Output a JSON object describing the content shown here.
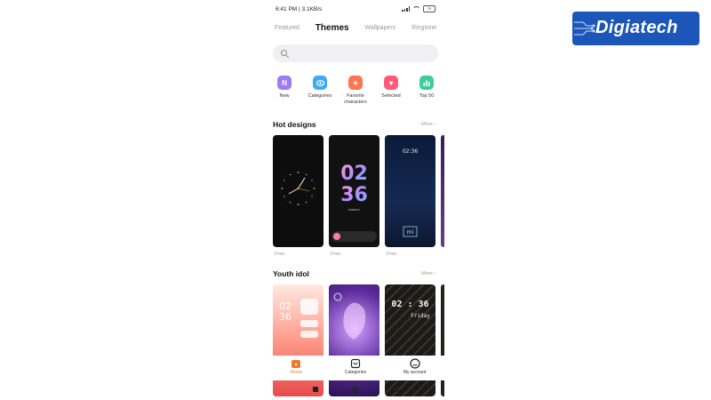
{
  "status": {
    "time": "6:41 PM",
    "speed": "3.1KB/s",
    "battery": "70"
  },
  "tabs": [
    {
      "label": "Featured"
    },
    {
      "label": "Themes"
    },
    {
      "label": "Wallpapers"
    },
    {
      "label": "Ringtone"
    }
  ],
  "search": {
    "placeholder": ""
  },
  "shortcuts": [
    {
      "label": "New",
      "icon": "new-icon",
      "color": "#9b7cf2"
    },
    {
      "label": "Categories",
      "icon": "categories-icon",
      "color": "#3fa9f5"
    },
    {
      "label": "Favorite characters",
      "icon": "star-icon",
      "color": "#ff7350"
    },
    {
      "label": "Selected",
      "icon": "heart-icon",
      "color": "#ff5a7a"
    },
    {
      "label": "Top 50",
      "icon": "bar-chart-icon",
      "color": "#3dcc9c"
    }
  ],
  "hot_designs": {
    "title": "Hot designs",
    "more": "More",
    "cards": [
      {
        "price": "Free",
        "text": ""
      },
      {
        "price": "Free",
        "text": "02\n36",
        "sub": "MONDAY"
      },
      {
        "price": "Free",
        "text": ""
      }
    ]
  },
  "youth_idol": {
    "title": "Youth idol",
    "more": "More",
    "cards": [
      {
        "text": "02\n36"
      },
      {
        "text": ""
      },
      {
        "text": "02 : 36",
        "sub": "Friday"
      }
    ]
  },
  "bottom_nav": [
    {
      "label": "Home",
      "icon": "home-icon"
    },
    {
      "label": "Categories",
      "icon": "categories-icon"
    },
    {
      "label": "My account",
      "icon": "account-icon"
    }
  ],
  "colors": {
    "accent": "#f07a2a",
    "logo_bg": "#1c56b8"
  },
  "watermark": {
    "text": "Digiatech"
  }
}
